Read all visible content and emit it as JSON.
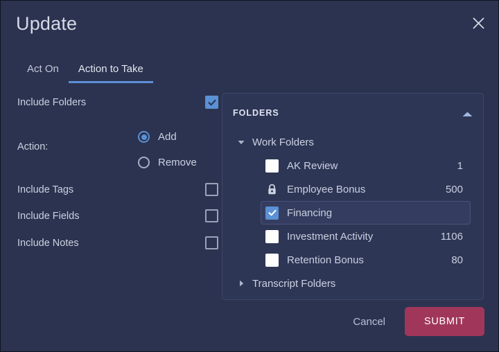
{
  "dialog": {
    "title": "Update",
    "close_icon": "close-icon"
  },
  "tabs": [
    {
      "label": "Act On",
      "active": false
    },
    {
      "label": "Action to Take",
      "active": true
    }
  ],
  "form": {
    "include_folders": {
      "label": "Include Folders",
      "checked": true
    },
    "action": {
      "label": "Action:",
      "options": [
        {
          "label": "Add",
          "selected": true
        },
        {
          "label": "Remove",
          "selected": false
        }
      ]
    },
    "include_tags": {
      "label": "Include Tags",
      "checked": false
    },
    "include_fields": {
      "label": "Include Fields",
      "checked": false
    },
    "include_notes": {
      "label": "Include Notes",
      "checked": false
    }
  },
  "folders_panel": {
    "header": "FOLDERS",
    "collapse_icon": "chevron-up-icon",
    "tree": [
      {
        "type": "group",
        "label": "Work Folders",
        "expanded": true,
        "caret_icon": "caret-down-icon",
        "children": [
          {
            "label": "AK Review",
            "count": "1",
            "checked": false,
            "locked": false,
            "selected": false
          },
          {
            "label": "Employee Bonus",
            "count": "500",
            "checked": false,
            "locked": true,
            "selected": false
          },
          {
            "label": "Financing",
            "count": "",
            "checked": true,
            "locked": false,
            "selected": true
          },
          {
            "label": "Investment Activity",
            "count": "1106",
            "checked": false,
            "locked": false,
            "selected": false
          },
          {
            "label": "Retention Bonus",
            "count": "80",
            "checked": false,
            "locked": false,
            "selected": false
          }
        ]
      },
      {
        "type": "group",
        "label": "Transcript Folders",
        "expanded": false,
        "caret_icon": "caret-right-icon",
        "children": []
      }
    ]
  },
  "footer": {
    "cancel_label": "Cancel",
    "submit_label": "SUBMIT"
  },
  "colors": {
    "dialog_bg": "#2b3350",
    "panel_bg": "#2e3656",
    "accent_blue": "#5b91d4",
    "submit_red": "#a0375b",
    "text": "#ccd2e0"
  }
}
